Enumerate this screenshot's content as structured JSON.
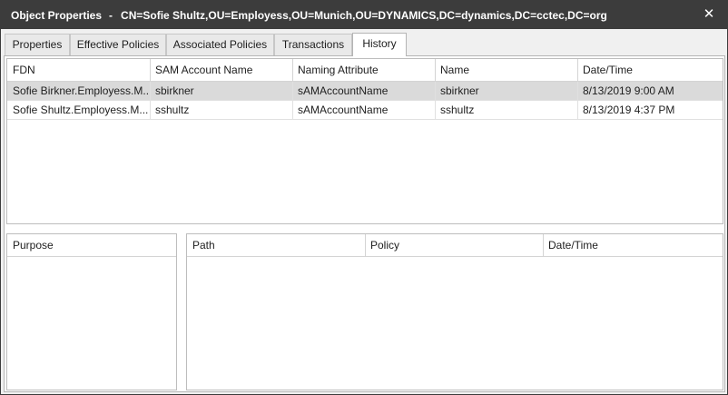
{
  "window": {
    "title": "Object Properties",
    "separator": "-",
    "subtitle": "CN=Sofie Shultz,OU=Employess,OU=Munich,OU=DYNAMICS,DC=dynamics,DC=cctec,DC=org",
    "close_glyph": "✕"
  },
  "tabs": [
    {
      "label": "Properties"
    },
    {
      "label": "Effective Policies"
    },
    {
      "label": "Associated Policies"
    },
    {
      "label": "Transactions"
    },
    {
      "label": "History",
      "active": true
    }
  ],
  "history": {
    "columns": [
      "FDN",
      "SAM Account Name",
      "Naming Attribute",
      "Name",
      "Date/Time"
    ],
    "rows": [
      {
        "fdn": "Sofie Birkner.Employess.M...",
        "sam": "sbirkner",
        "naming": "sAMAccountName",
        "name": "sbirkner",
        "datetime": "8/13/2019 9:00 AM",
        "selected": true
      },
      {
        "fdn": "Sofie Shultz.Employess.M...",
        "sam": "sshultz",
        "naming": "sAMAccountName",
        "name": "sshultz",
        "datetime": "8/13/2019 4:37 PM"
      }
    ]
  },
  "purpose": {
    "header": "Purpose"
  },
  "paths": {
    "columns": [
      "Path",
      "Policy",
      "Date/Time"
    ]
  }
}
